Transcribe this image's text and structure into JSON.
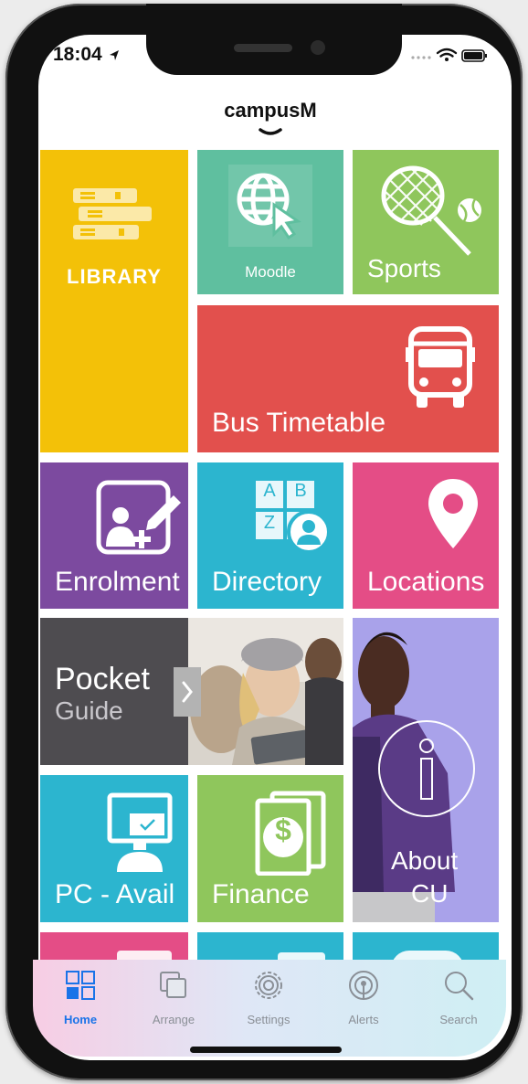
{
  "status_bar": {
    "time": "18:04"
  },
  "header": {
    "title": "campusM"
  },
  "tiles": {
    "library": {
      "label": "LIBRARY",
      "color": "#f3c108"
    },
    "moodle": {
      "label": "Moodle",
      "color": "#5fbf9f"
    },
    "sports": {
      "label": "Sports",
      "color": "#8fc65c"
    },
    "bus": {
      "label": "Bus Timetable",
      "color": "#e2504d"
    },
    "enrolment": {
      "label": "Enrolment",
      "color": "#7c4a9f"
    },
    "directory": {
      "label": "Directory",
      "color": "#2cb5cf"
    },
    "directory_letters": [
      "A",
      "B",
      "Z"
    ],
    "locations": {
      "label": "Locations",
      "color": "#e44d86"
    },
    "pocket": {
      "title": "Pocket",
      "subtitle": "Guide",
      "color": "#4e4c50"
    },
    "about": {
      "label_line1": "About",
      "label_line2": "CU",
      "color": "#a9a2ea"
    },
    "pc": {
      "label": "PC - Avail",
      "color": "#2cb5cf"
    },
    "finance": {
      "label": "Finance",
      "color": "#8fc65c"
    }
  },
  "tab_bar": {
    "items": [
      {
        "label": "Home",
        "active": true
      },
      {
        "label": "Arrange",
        "active": false
      },
      {
        "label": "Settings",
        "active": false
      },
      {
        "label": "Alerts",
        "active": false
      },
      {
        "label": "Search",
        "active": false
      }
    ],
    "active_color": "#1a73e8"
  }
}
